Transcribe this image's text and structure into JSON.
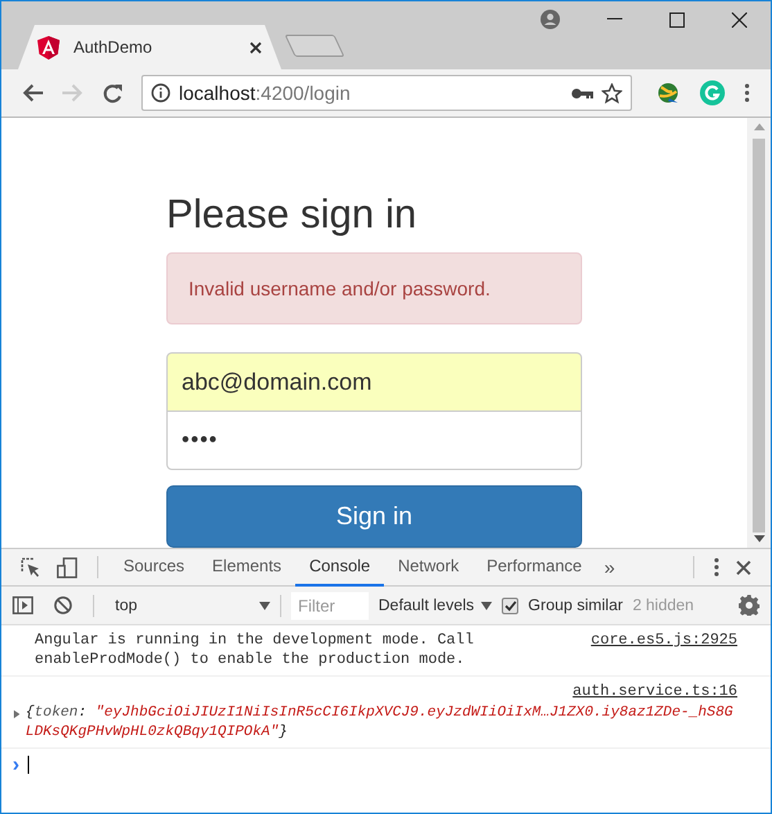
{
  "browser": {
    "tabs": [
      {
        "title": "AuthDemo",
        "selected": true
      }
    ],
    "address": {
      "host": "localhost",
      "path": ":4200/login"
    }
  },
  "page": {
    "heading": "Please sign in",
    "alert": "Invalid username and/or password.",
    "fields": [
      {
        "kind": "text",
        "value": "abc@domain.com",
        "autofilled": true
      },
      {
        "kind": "password",
        "value": "••••",
        "autofilled": false
      }
    ],
    "button": "Sign in"
  },
  "devtools": {
    "tabs": [
      {
        "label": "Sources",
        "selected": false
      },
      {
        "label": "Elements",
        "selected": false
      },
      {
        "label": "Console",
        "selected": true
      },
      {
        "label": "Network",
        "selected": false
      },
      {
        "label": "Performance",
        "selected": false
      }
    ],
    "more": "»",
    "context": "top",
    "filter_placeholder": "Filter",
    "levels": "Default levels",
    "group_similar": {
      "label": "Group similar",
      "checked": true
    },
    "hidden": "2 hidden",
    "messages": [
      {
        "kind": "log",
        "text": "Angular is running in the development mode. Call enableProdMode() to enable the production mode.",
        "source": "core.es5.js:2925"
      },
      {
        "kind": "object",
        "source": "auth.service.ts:16",
        "open": "{",
        "key": "token",
        "colon": ":",
        "close": "}",
        "value": "\"eyJhbGciOiJIUzI1NiIsInR5cCI6IkpXVCJ9.eyJzdWIiOiIxM…J1ZX0.iy8az1ZDe-_hS8GLDKsQKgPHvWpHL0zkQBqy1QIPOkA\""
      }
    ],
    "prompt": "›"
  }
}
